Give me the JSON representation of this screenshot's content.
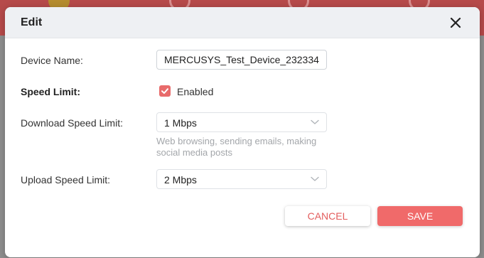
{
  "dialog": {
    "title": "Edit"
  },
  "form": {
    "device_name_label": "Device Name:",
    "device_name_value": "MERCUSYS_Test_Device_232334",
    "speed_limit_label": "Speed Limit:",
    "speed_limit_checkbox_label": "Enabled",
    "speed_limit_enabled": true,
    "download_label": "Download Speed Limit:",
    "download_value": "1 Mbps",
    "download_hint": "Web browsing, sending emails, making social media posts",
    "upload_label": "Upload Speed Limit:",
    "upload_value": "2 Mbps"
  },
  "buttons": {
    "cancel_label": "CANCEL",
    "save_label": "SAVE"
  },
  "colors": {
    "accent": "#f06a6a",
    "checkbox": "#e86b6b",
    "cancel_text": "#e35d5d",
    "header_bg": "#eef0f3",
    "background_app_header": "#b64a4a"
  },
  "icons": {
    "close": "close-icon",
    "check": "checkmark-icon",
    "dropdown": "chevron-down-icon"
  }
}
